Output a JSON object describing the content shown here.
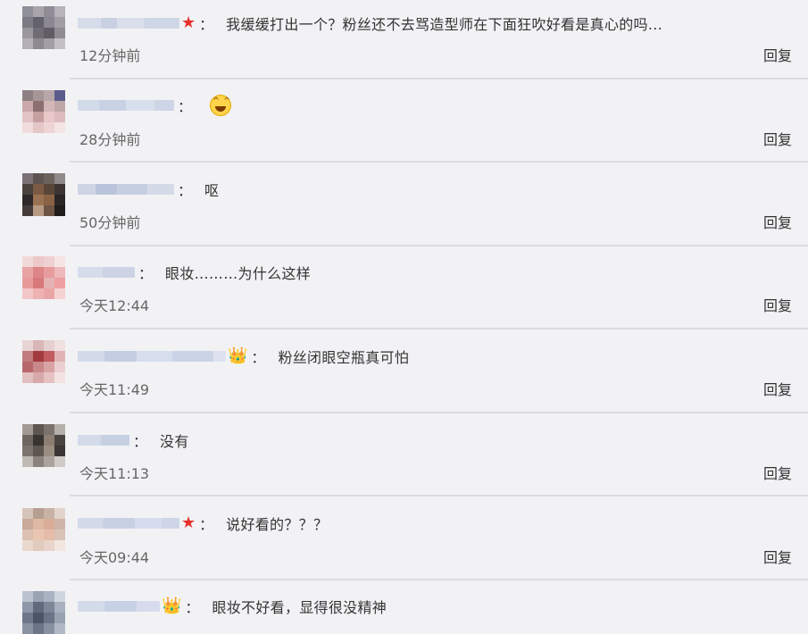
{
  "reply_label": "回复",
  "comments": [
    {
      "badge": "★",
      "text": "我缓缓打出一个？粉丝还不去骂造型师在下面狂吹好看是真心的吗...",
      "time": "12分钟前"
    },
    {
      "badge": "",
      "emoji": "laughing-tears-emoji",
      "text": "",
      "time": "28分钟前"
    },
    {
      "badge": "",
      "text": "呕",
      "time": "50分钟前"
    },
    {
      "badge": "",
      "text": "眼妆………为什么这样",
      "time": "今天12:44"
    },
    {
      "badge": "👑",
      "text": "粉丝闭眼空瓶真可怕",
      "time": "今天11:49"
    },
    {
      "badge": "",
      "text": "没有",
      "time": "今天11:13"
    },
    {
      "badge": "★",
      "text": "说好看的？？？",
      "time": "今天09:44"
    },
    {
      "badge": "👑",
      "text": "眼妆不好看，显得很没精神",
      "time": ""
    }
  ],
  "colon": "："
}
